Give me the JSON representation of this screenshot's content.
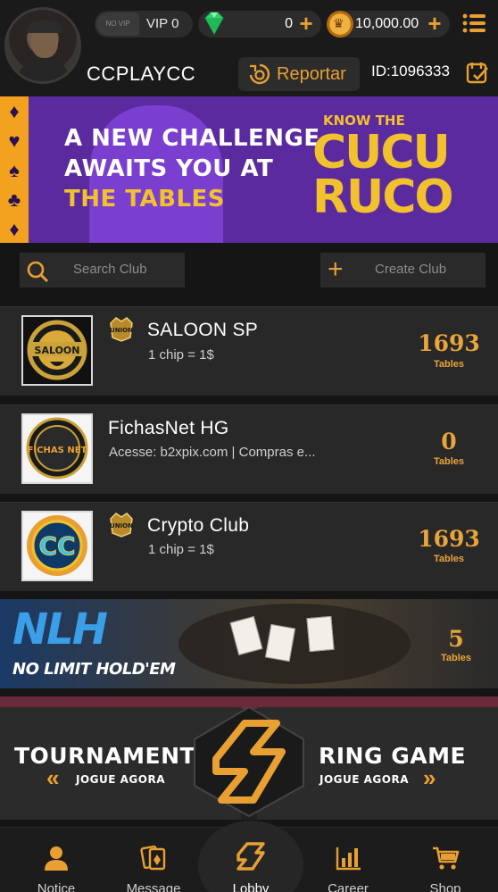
{
  "header": {
    "vip_tag": "NO VIP",
    "vip_level": "VIP 0",
    "gems": "0",
    "coins": "10,000.00",
    "username": "CCPLAYCC",
    "report_label": "Reportar",
    "user_id": "ID:1096333"
  },
  "banner": {
    "line1": "A NEW CHALLENGE",
    "line2": "AWAITS YOU AT",
    "line3": "THE TABLES",
    "know": "KNOW THE",
    "logo_top": "CUCU",
    "logo_bottom": "RUCO"
  },
  "search": {
    "placeholder": "Search Club"
  },
  "create": {
    "label": "Create Club"
  },
  "clubs": [
    {
      "name": "SALOON SP",
      "desc": "1 chip = 1$",
      "tables": "1693",
      "tables_label": "Tables",
      "logo_text": "SALOON",
      "union_badge": "UNION"
    },
    {
      "name": "FichasNet HG",
      "desc": "Acesse: b2xpix.com | Compras e...",
      "tables": "0",
      "tables_label": "Tables",
      "logo_text": "FICHAS NET"
    },
    {
      "name": "Crypto Club",
      "desc": "1 chip = 1$",
      "tables": "1693",
      "tables_label": "Tables",
      "logo_text": "CC",
      "union_badge": "UNION"
    }
  ],
  "nlh": {
    "title": "NLH",
    "subtitle": "NO LIMIT HOLD'EM",
    "tables": "5",
    "tables_label": "Tables"
  },
  "modes": {
    "tournament": "TOURNAMENT",
    "tournament_cta": "JOGUE AGORA",
    "ring": "RING GAME",
    "ring_cta": "JOGUE AGORA"
  },
  "nav": [
    {
      "label": "Notice",
      "icon": "user-icon"
    },
    {
      "label": "Message",
      "icon": "cards-icon"
    },
    {
      "label": "Lobby",
      "icon": "lobby-logo-icon"
    },
    {
      "label": "Career",
      "icon": "bar-chart-icon"
    },
    {
      "label": "Shop",
      "icon": "cart-icon"
    }
  ],
  "colors": {
    "accent": "#e8a033",
    "banner": "#5b2a9e",
    "row": "#282828",
    "background": "#151515"
  }
}
